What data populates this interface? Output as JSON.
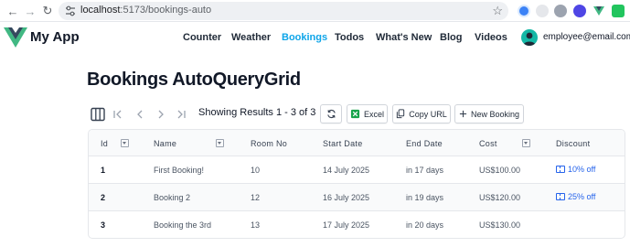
{
  "browser": {
    "url_host": "localhost",
    "url_path": ":5173/bookings-auto"
  },
  "app": {
    "title": "My App",
    "nav": [
      {
        "label": "Counter",
        "active": false
      },
      {
        "label": "Weather",
        "active": false
      },
      {
        "label": "Bookings",
        "active": true
      },
      {
        "label": "Todos",
        "active": false
      },
      {
        "label": "What's New",
        "active": false
      },
      {
        "label": "Blog",
        "active": false
      },
      {
        "label": "Videos",
        "active": false
      }
    ],
    "user_email": "employee@email.com"
  },
  "page": {
    "title": "Bookings AutoQueryGrid"
  },
  "toolbar": {
    "results": "Showing Results 1 - 3 of 3",
    "excel_label": "Excel",
    "copy_url_label": "Copy URL",
    "new_label": "New Booking"
  },
  "grid": {
    "columns": [
      "Id",
      "Name",
      "Room No",
      "Start Date",
      "End Date",
      "Cost",
      "Discount"
    ],
    "rows": [
      {
        "id": "1",
        "name": "First Booking!",
        "room": "10",
        "start": "14 July 2025",
        "end": "in 17 days",
        "cost": "US$100.00",
        "discount": "10% off"
      },
      {
        "id": "2",
        "name": "Booking 2",
        "room": "12",
        "start": "16 July 2025",
        "end": "in 19 days",
        "cost": "US$120.00",
        "discount": "25% off"
      },
      {
        "id": "3",
        "name": "Booking the 3rd",
        "room": "13",
        "start": "17 July 2025",
        "end": "in 20 days",
        "cost": "US$130.00",
        "discount": ""
      }
    ]
  },
  "colors": {
    "accent": "#0ea5e9",
    "link": "#2563eb",
    "vue_green": "#41b883",
    "vue_dark": "#35495e",
    "excel_green": "#16a34a"
  }
}
